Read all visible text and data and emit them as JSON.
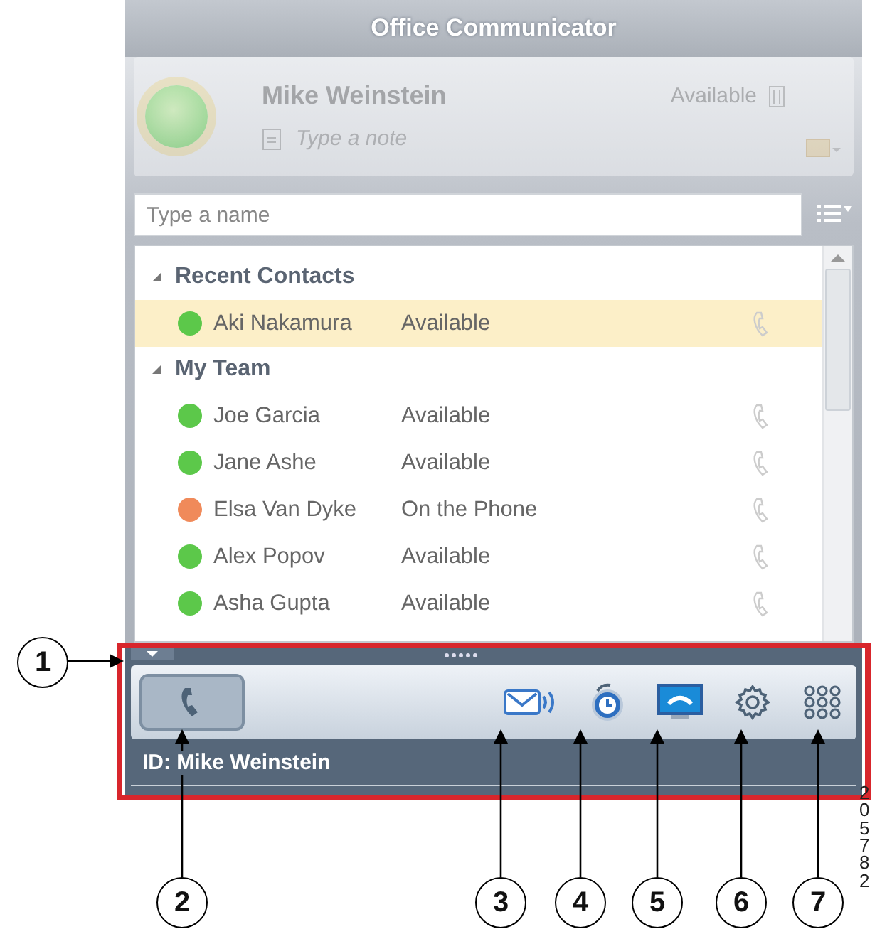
{
  "window": {
    "title": "Office Communicator"
  },
  "me": {
    "name": "Mike Weinstein",
    "status": "Available",
    "note_placeholder": "Type a note"
  },
  "search": {
    "placeholder": "Type a name"
  },
  "groups": [
    {
      "label": "Recent Contacts",
      "expanded": true,
      "contacts": [
        {
          "name": "Aki Nakamura",
          "status": "Available",
          "color": "#5cc84a",
          "selected": true
        }
      ]
    },
    {
      "label": "My Team",
      "expanded": true,
      "contacts": [
        {
          "name": "Joe Garcia",
          "status": "Available",
          "color": "#5cc84a",
          "selected": false
        },
        {
          "name": "Jane Ashe",
          "status": "Available",
          "color": "#5cc84a",
          "selected": false
        },
        {
          "name": "Elsa Van Dyke",
          "status": "On the Phone",
          "color": "#f08a5a",
          "selected": false
        },
        {
          "name": "Alex Popov",
          "status": "Available",
          "color": "#5cc84a",
          "selected": false
        },
        {
          "name": "Asha Gupta",
          "status": "Available",
          "color": "#5cc84a",
          "selected": false
        }
      ]
    }
  ],
  "phone_bar": {
    "id_label": "ID: Mike Weinstein",
    "buttons": [
      {
        "kind": "phone",
        "selected": true
      },
      {
        "kind": "voicemail",
        "selected": false
      },
      {
        "kind": "recent",
        "selected": false
      },
      {
        "kind": "screen",
        "selected": false
      },
      {
        "kind": "settings",
        "selected": false
      },
      {
        "kind": "keypad",
        "selected": false
      }
    ]
  },
  "callouts": [
    "1",
    "2",
    "3",
    "4",
    "5",
    "6",
    "7"
  ],
  "figure_number": "205782"
}
